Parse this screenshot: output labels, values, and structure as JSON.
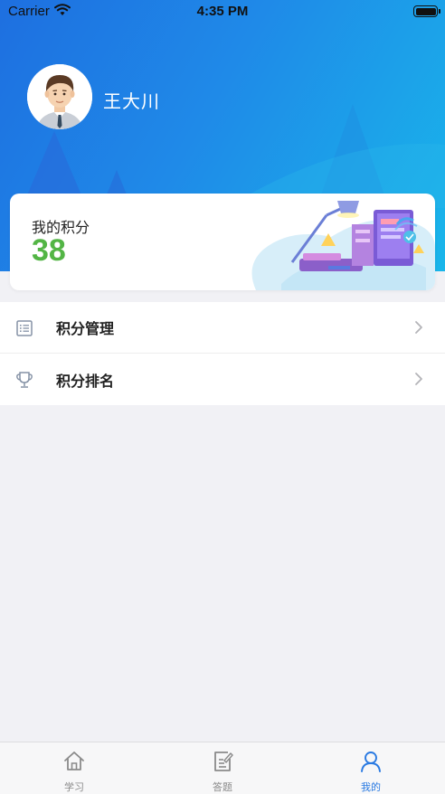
{
  "status_bar": {
    "carrier": "Carrier",
    "time": "4:35 PM"
  },
  "profile": {
    "name": "王大川"
  },
  "points": {
    "label": "我的积分",
    "value": "38"
  },
  "menu": [
    {
      "label": "积分管理",
      "icon": "list-icon"
    },
    {
      "label": "积分排名",
      "icon": "trophy-icon"
    }
  ],
  "tabbar": {
    "active": "我的",
    "tabs": [
      {
        "label": "学习",
        "icon": "home-icon"
      },
      {
        "label": "答题",
        "icon": "edit-document-icon"
      },
      {
        "label": "我的",
        "icon": "user-icon"
      }
    ]
  },
  "colors": {
    "header_start": "#1e6fe0",
    "header_end": "#19b6ea",
    "points_green": "#53b545",
    "tab_active": "#2a7ae2"
  }
}
